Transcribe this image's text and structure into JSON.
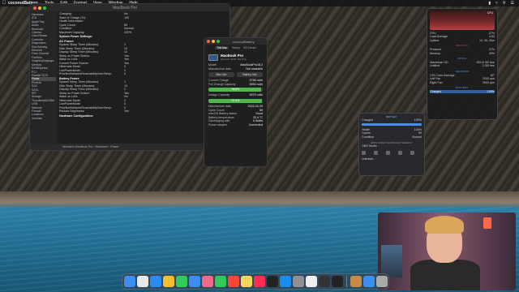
{
  "menubar": {
    "app": "coconutBattery",
    "items": [
      "Tools",
      "Edit",
      "Format",
      "View",
      "Window",
      "Help"
    ]
  },
  "sysinfo": {
    "title": "MacBook Pro",
    "sidebar": [
      "Hardware",
      "ATA",
      "Apple Pay",
      "Audio",
      "Bluetooth",
      "Camera",
      "Card Reader",
      "Controller",
      "Diagnostics",
      "Disc Burning",
      "Ethernet",
      "Fibre Channel",
      "FireWire",
      "Graphics/Displays",
      "Memory",
      "NVMExpress",
      "PCI",
      "Parallel SCSI",
      "Power",
      "Printers",
      "SAS",
      "SATA",
      "SPI",
      "Storage",
      "Thunderbolt/USB4",
      "USB",
      "Network",
      "Firewall",
      "Locations",
      "Volumes"
    ],
    "selected": "Power",
    "rows": [
      {
        "k": "Charging:",
        "v": "No"
      },
      {
        "k": "State of Charge (%):",
        "v": "100"
      },
      {
        "k": "Health Information:",
        "v": ""
      },
      {
        "k": "Cycle Count:",
        "v": "69"
      },
      {
        "k": "Condition:",
        "v": "Normal"
      },
      {
        "k": "Maximum Capacity:",
        "v": "100%"
      }
    ],
    "power_settings_title": "System Power Settings:",
    "ac_title": "AC Power:",
    "ac_rows": [
      {
        "k": "System Sleep Timer (Minutes):",
        "v": "1"
      },
      {
        "k": "Disk Sleep Timer (Minutes):",
        "v": "10"
      },
      {
        "k": "Display Sleep Timer (Minutes):",
        "v": "10"
      },
      {
        "k": "Sleep on Power Button:",
        "v": "Yes"
      },
      {
        "k": "Wake on LAN:",
        "v": "Yes"
      },
      {
        "k": "Current Power Source:",
        "v": "Yes"
      },
      {
        "k": "Hibernate Mode:",
        "v": "3"
      },
      {
        "k": "LowPowerMode:",
        "v": "0"
      },
      {
        "k": "PrioritizeNetworkReachabilityOverSleep:",
        "v": "0"
      }
    ],
    "battery_title": "Battery Power:",
    "battery_rows": [
      {
        "k": "System Sleep Timer (Minutes):",
        "v": "1"
      },
      {
        "k": "Disk Sleep Timer (Minutes):",
        "v": "10"
      },
      {
        "k": "Display Sleep Timer (Minutes):",
        "v": "2"
      },
      {
        "k": "Sleep on Power Button:",
        "v": "Yes"
      },
      {
        "k": "Wake on LAN:",
        "v": "No"
      },
      {
        "k": "Hibernate Mode:",
        "v": "3"
      },
      {
        "k": "LowPowerMode:",
        "v": "0"
      },
      {
        "k": "PrioritizeNetworkReachabilityOverSleep:",
        "v": "0"
      },
      {
        "k": "Reduce Brightness:",
        "v": "Yes"
      }
    ],
    "hardware_config": "Hardware Configuration:",
    "path": "Michael's MacBook Pro › Hardware › Power"
  },
  "coconut": {
    "title": "coconutBattery",
    "tabs": [
      "This Mac",
      "History",
      "iOS Device"
    ],
    "model_name": "MacBook Pro",
    "model_sub": "(16-inch, 2021, M1 Pro)",
    "rows_top": [
      {
        "k": "Model",
        "v": "MacBookPro18,3"
      },
      {
        "k": "Manufacture date",
        "v": "Not readable"
      }
    ],
    "btn_mac_info": "Mac Info",
    "btn_battery_info": "Battery Info",
    "current_charge": {
      "k": "Current Charge",
      "v": "5768 mAh"
    },
    "full_capacity": {
      "k": "Full Charge Capacity",
      "v": "5950 mAh"
    },
    "charge_pct": "96.6%",
    "charge_frac": 0.966,
    "design_capacity": {
      "k": "Design Capacity",
      "v": "6075 mAh"
    },
    "capacity_pct": "97.9%",
    "capacity_frac": 0.979,
    "rows_bottom": [
      {
        "k": "Manufacture date",
        "v": "2022-03-29"
      },
      {
        "k": "Cycle Count",
        "v": "69"
      },
      {
        "k": "macOS Battery status",
        "v": "Good"
      },
      {
        "k": "Battery temperature",
        "v": "32.4 °C"
      },
      {
        "k": "Discharging with",
        "v": "0 Watts"
      },
      {
        "k": "Power adapter",
        "v": "Connected"
      }
    ]
  },
  "popover": {
    "head": "BATTERY",
    "charge_label": "Charged",
    "charge_value": "100%",
    "charge_frac": 1.0,
    "health_label": "Health",
    "health_value": "100%",
    "cycles_label": "Cycles",
    "cycles_value": "69",
    "condition_label": "Condition",
    "condition_value": "Normal",
    "apps_head": "APPS USING SIGNIFICANT ENERGY",
    "app": "OBS Studio",
    "footer": "Uninstall..."
  },
  "stats": {
    "cpu_head": "CPU",
    "cpu_value": "27%",
    "rows1": [
      {
        "k": "CPU",
        "v": "27%"
      },
      {
        "k": "Load Average",
        "v": "4.63"
      },
      {
        "k": "Uptime",
        "v": "14, 4h, 45m"
      }
    ],
    "mem_head": "MEMORY",
    "rows2": [
      {
        "k": "Pressure",
        "v": "27%"
      },
      {
        "k": "Memory",
        "v": "39%"
      }
    ],
    "disk_head": "DISKS",
    "rows3": [
      {
        "k": "Macintosh HD",
        "v": "833.6 GB free"
      },
      {
        "k": "Untitled",
        "v": "2 GB free"
      }
    ],
    "sensors_head": "SENSORS",
    "rows4": [
      {
        "k": "CPU Core Average",
        "v": "45°"
      },
      {
        "k": "Left Fan",
        "v": "2305 rpm"
      },
      {
        "k": "Right Fan",
        "v": "2503 rpm"
      }
    ],
    "battery_head": "BATTERY",
    "battery_row": {
      "k": "Charged",
      "v": "100%"
    }
  },
  "dock": {
    "icons": [
      "finder-icon",
      "launchpad-icon",
      "safari-icon",
      "chrome-icon",
      "messages-icon",
      "mail-icon",
      "photos-icon",
      "facetime-icon",
      "calendar-icon",
      "notes-icon",
      "music-icon",
      "tv-icon",
      "appstore-icon",
      "settings-icon",
      "notion-icon",
      "obs-icon",
      "terminal-icon",
      "coconut-icon",
      "finder-window-icon",
      "trash-icon"
    ]
  }
}
